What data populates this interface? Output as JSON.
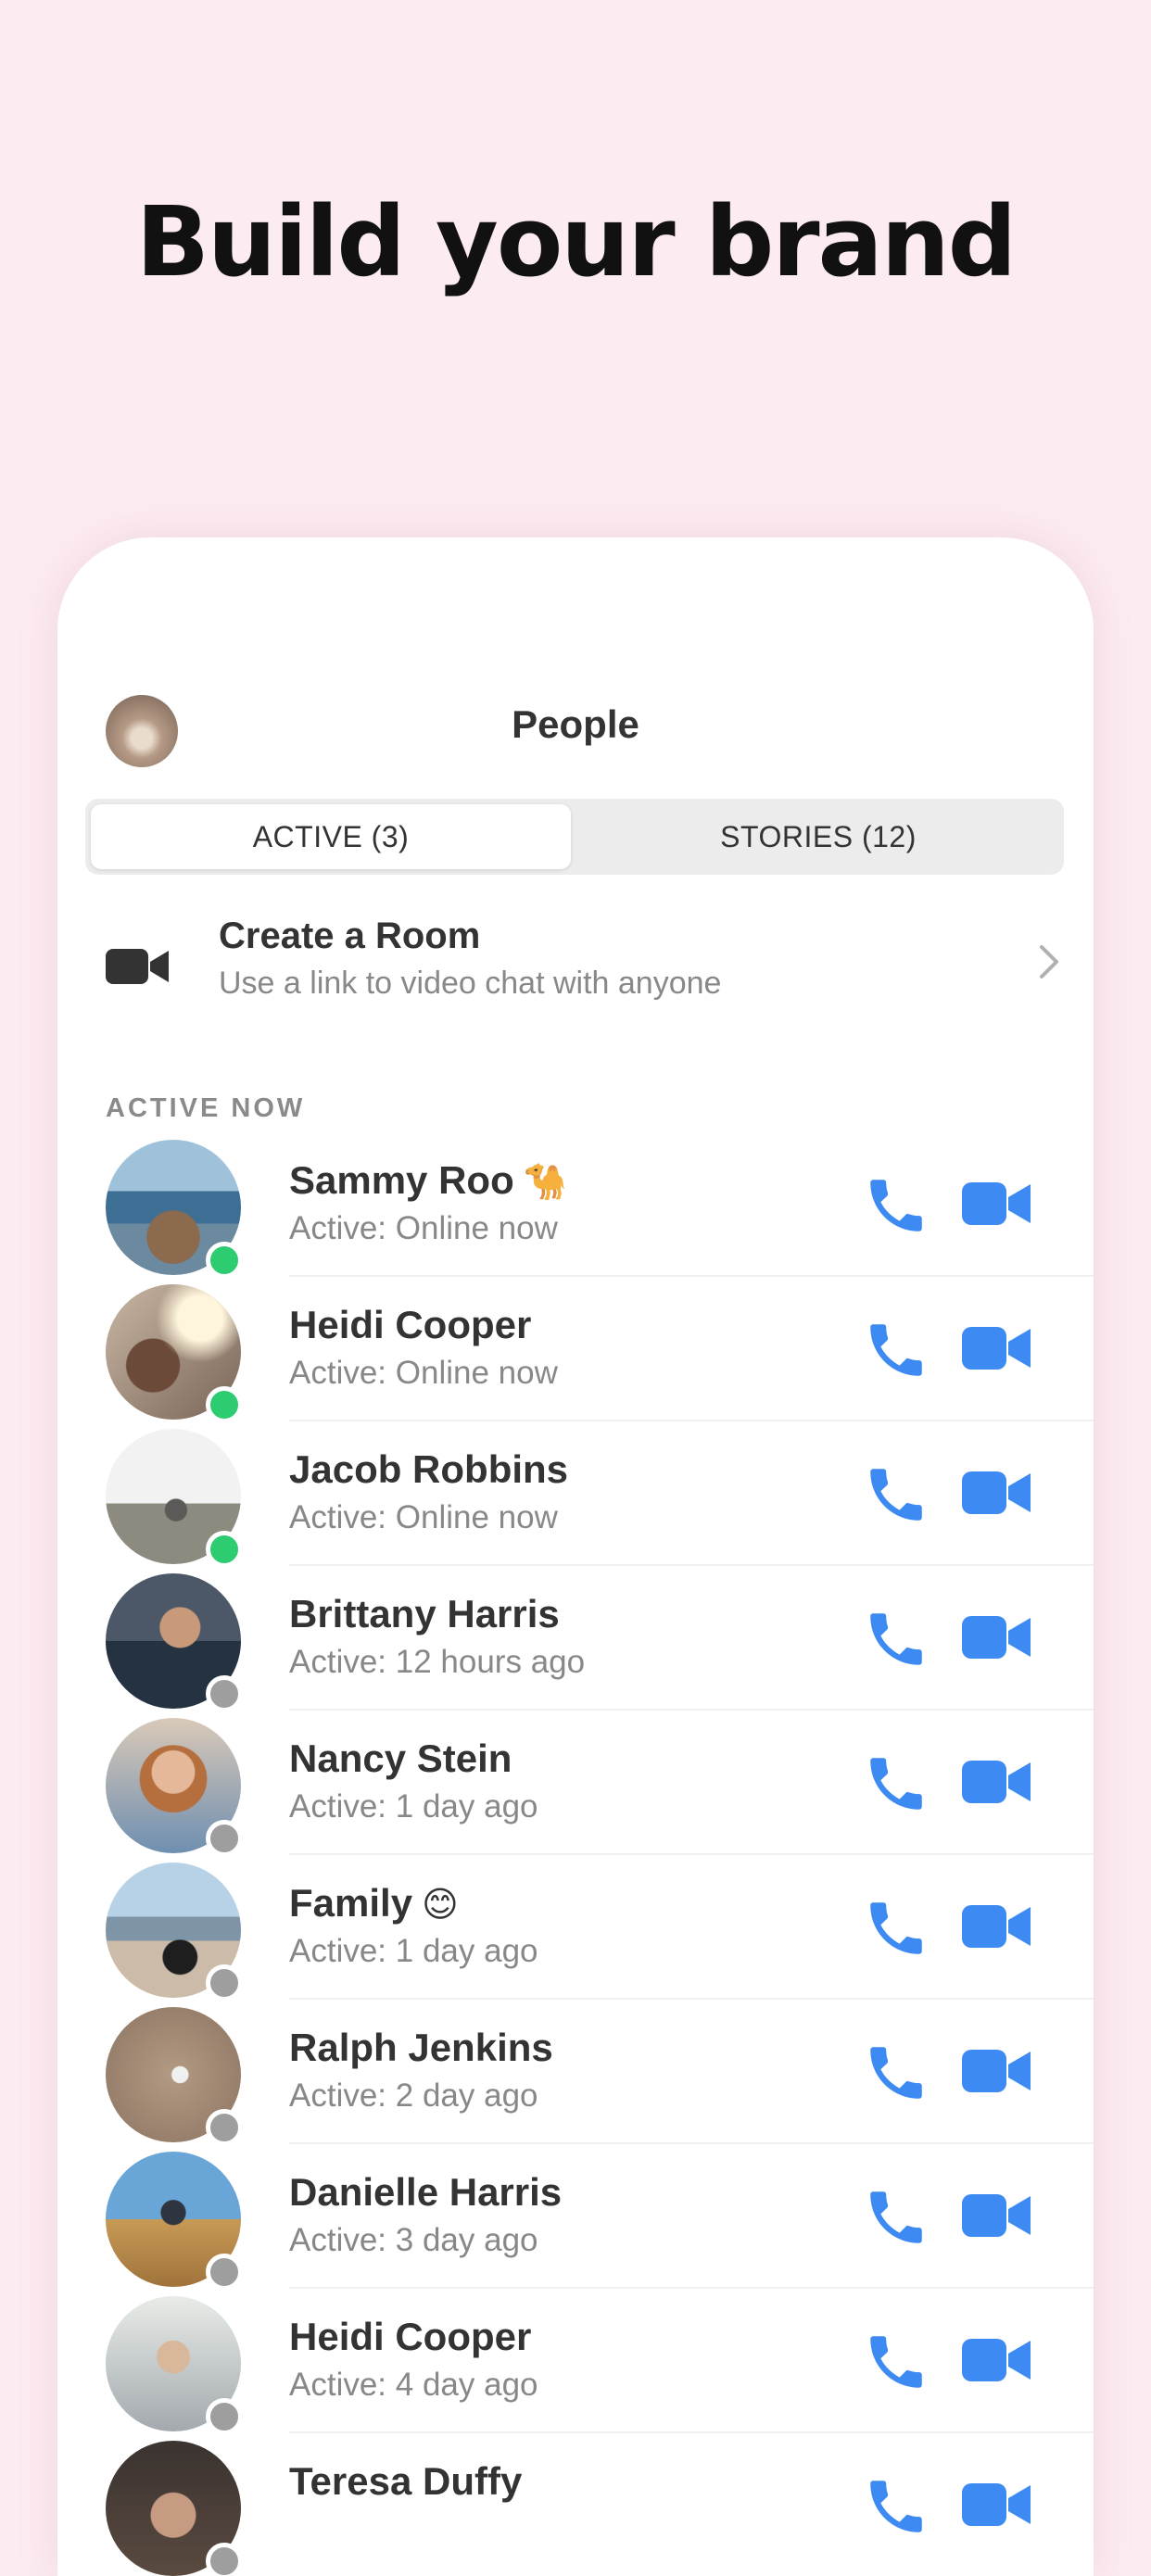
{
  "headline": "Build your brand",
  "header": {
    "title": "People"
  },
  "tabs": [
    {
      "label": "ACTIVE (3)",
      "selected": true
    },
    {
      "label": "STORIES (12)",
      "selected": false
    }
  ],
  "create_room": {
    "title": "Create a Room",
    "subtitle": "Use a link to video chat with anyone"
  },
  "section_label": "ACTIVE NOW",
  "colors": {
    "background": "#fcebf0",
    "accent_blue": "#3d8bf2",
    "online_green": "#2ecc71",
    "offline_gray": "#9e9e9e"
  },
  "people": [
    {
      "name": "Sammy Roo",
      "emoji": "🐪",
      "status": "Active: Online now",
      "online": true
    },
    {
      "name": "Heidi Cooper",
      "emoji": "",
      "status": "Active: Online now",
      "online": true
    },
    {
      "name": "Jacob Robbins",
      "emoji": "",
      "status": "Active: Online now",
      "online": true
    },
    {
      "name": "Brittany Harris",
      "emoji": "",
      "status": "Active: 12 hours ago",
      "online": false
    },
    {
      "name": "Nancy Stein",
      "emoji": "",
      "status": "Active: 1 day ago",
      "online": false
    },
    {
      "name": "Family",
      "emoji": "😊",
      "status": "Active: 1 day ago",
      "online": false
    },
    {
      "name": "Ralph Jenkins",
      "emoji": "",
      "status": "Active: 2 day ago",
      "online": false
    },
    {
      "name": "Danielle Harris",
      "emoji": "",
      "status": "Active: 3 day ago",
      "online": false
    },
    {
      "name": "Heidi Cooper",
      "emoji": "",
      "status": "Active: 4 day ago",
      "online": false
    },
    {
      "name": "Teresa Duffy",
      "emoji": "",
      "status": "",
      "online": false
    }
  ],
  "icons": {
    "room": "video-camera-icon",
    "chevron": "chevron-right-icon",
    "call": "phone-icon",
    "video": "video-camera-icon"
  }
}
